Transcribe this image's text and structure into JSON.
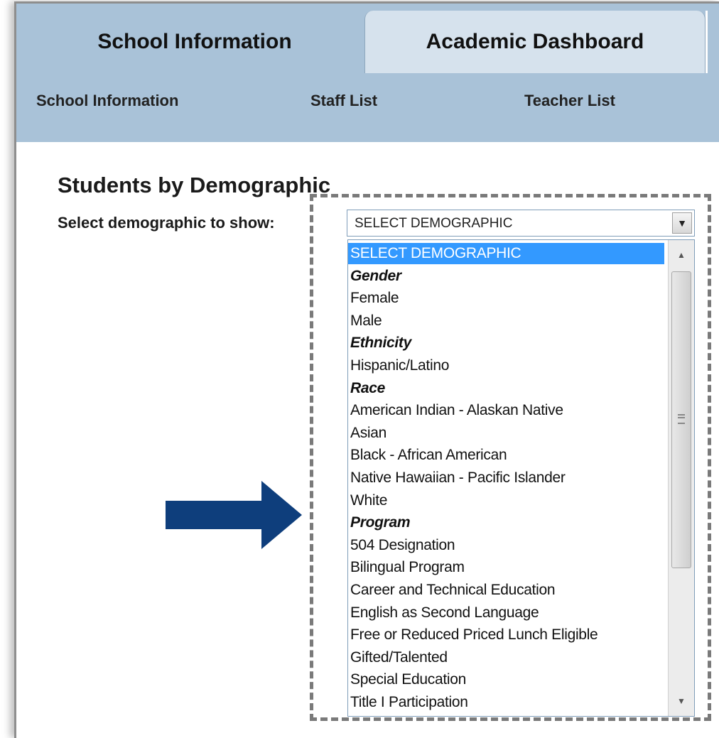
{
  "tabs": [
    {
      "label": "School Information",
      "active": true
    },
    {
      "label": "Academic Dashboard",
      "active": false
    }
  ],
  "subnav": [
    {
      "label": "School Information"
    },
    {
      "label": "Staff List"
    },
    {
      "label": "Teacher List"
    }
  ],
  "heading": "Students by Demographic",
  "select": {
    "label": "Select demographic to show:",
    "value": "SELECT DEMOGRAPHIC",
    "arrow_icon": "chevron-down-icon",
    "options": [
      {
        "label": "SELECT DEMOGRAPHIC",
        "group": false,
        "selected": true
      },
      {
        "label": "Gender",
        "group": true
      },
      {
        "label": "Female",
        "group": false
      },
      {
        "label": "Male",
        "group": false
      },
      {
        "label": "Ethnicity",
        "group": true
      },
      {
        "label": "Hispanic/Latino",
        "group": false
      },
      {
        "label": "Race",
        "group": true
      },
      {
        "label": "American Indian - Alaskan Native",
        "group": false
      },
      {
        "label": "Asian",
        "group": false
      },
      {
        "label": "Black - African American",
        "group": false
      },
      {
        "label": "Native Hawaiian - Pacific Islander",
        "group": false
      },
      {
        "label": "White",
        "group": false
      },
      {
        "label": "Program",
        "group": true
      },
      {
        "label": "504 Designation",
        "group": false
      },
      {
        "label": "Bilingual Program",
        "group": false
      },
      {
        "label": "Career and Technical Education",
        "group": false
      },
      {
        "label": "English as Second Language",
        "group": false
      },
      {
        "label": "Free or Reduced Priced Lunch Eligible",
        "group": false
      },
      {
        "label": "Gifted/Talented",
        "group": false
      },
      {
        "label": "Special Education",
        "group": false
      },
      {
        "label": "Title I Participation",
        "group": false
      }
    ]
  },
  "annotation": {
    "arrow_icon": "arrow-right-icon",
    "arrow_color": "#0e3e7c",
    "highlight": "dashed-border"
  },
  "colors": {
    "tab_bar": "#a9c2d8",
    "tab_inactive": "#d6e2ed",
    "selection": "#3399ff"
  }
}
